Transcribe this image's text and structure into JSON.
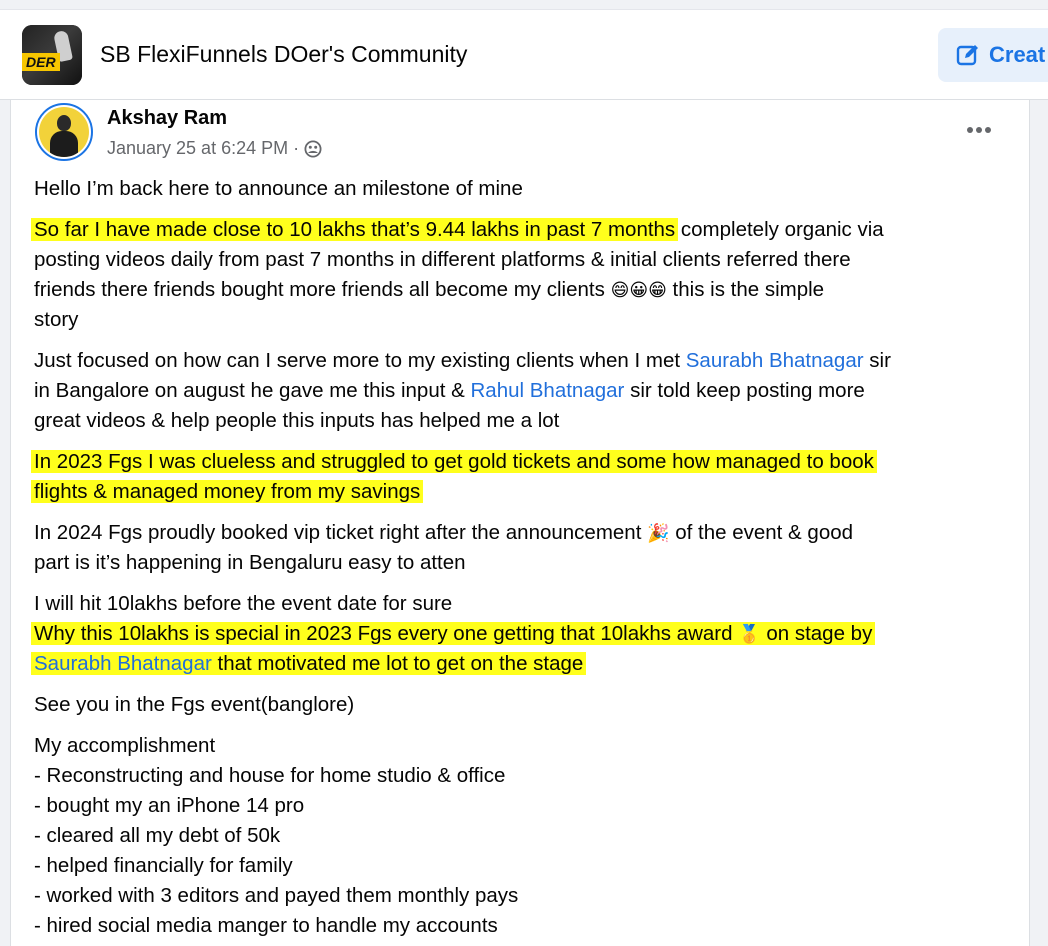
{
  "group": {
    "title": "SB FlexiFunnels DOer's Community",
    "logo_text": "DER",
    "create_label": "Creat",
    "icon": "edit-icon"
  },
  "post": {
    "author": "Akshay Ram",
    "timestamp": "January 25 at 6:24 PM",
    "meta_separator": "·",
    "privacy_icon": "group-privacy-icon",
    "more_icon": "more-options-icon",
    "p1": "Hello I’m back here to announce an milestone of mine",
    "p2_hl": "So far I have made close to 10 lakhs that’s 9.44 lakhs in past 7 months",
    "p2_rest1": " completely organic via",
    "p2_line2": "posting videos daily from past 7 months in different platforms & initial clients referred there",
    "p2_line3": "friends there friends bought more friends all become my clients",
    "p2_emojis": "😄😀😁",
    "p2_line3_end": " this is the simple",
    "p2_line4": "story",
    "p3_a": "Just focused on how can I serve more to my existing clients  when I met ",
    "mention1": "Saurabh Bhatnagar",
    "p3_b": " sir",
    "p3_line2a": "in Bangalore on august he gave me this input & ",
    "mention2": "Rahul Bhatnagar",
    "p3_line2b": " sir told keep posting more",
    "p3_line3": "great videos & help people this inputs has helped me a lot",
    "p4_line1": "In 2023 Fgs I was clueless and struggled to get gold tickets and some how managed to book",
    "p4_line2": "flights & managed money from my savings ",
    "p5_line1a": "In 2024 Fgs proudly booked vip ticket right after the announcement ",
    "p5_emoji": "🎉",
    "p5_line1b": " of the event & good",
    "p5_line2": "part is it’s happening in Bengaluru easy to atten",
    "p6_line1": "I will hit 10lakhs before the event date for sure",
    "p6_line2a": "Why this 10lakhs is special in 2023 Fgs every one getting that 10lakhs award ",
    "p6_emoji": "🥇",
    "p6_line2b": " on stage by",
    "mention3": "Saurabh Bhatnagar",
    "p6_line3b": " that motivated me lot to get on the stage ",
    "p7": "See you in the Fgs event(banglore)",
    "accomplishments_title": "My accomplishment",
    "accomplishments": [
      "- Reconstructing and house for home studio & office",
      "- bought my an iPhone 14 pro",
      "- cleared all my debt of 50k",
      "- helped financially for family",
      "- worked with 3 editors and payed them monthly pays",
      "- hired social media manger to handle my accounts"
    ]
  },
  "colors": {
    "highlight": "#ffff1c",
    "link": "#216fdb",
    "accent": "#1b74e4",
    "muted": "#65676b"
  }
}
